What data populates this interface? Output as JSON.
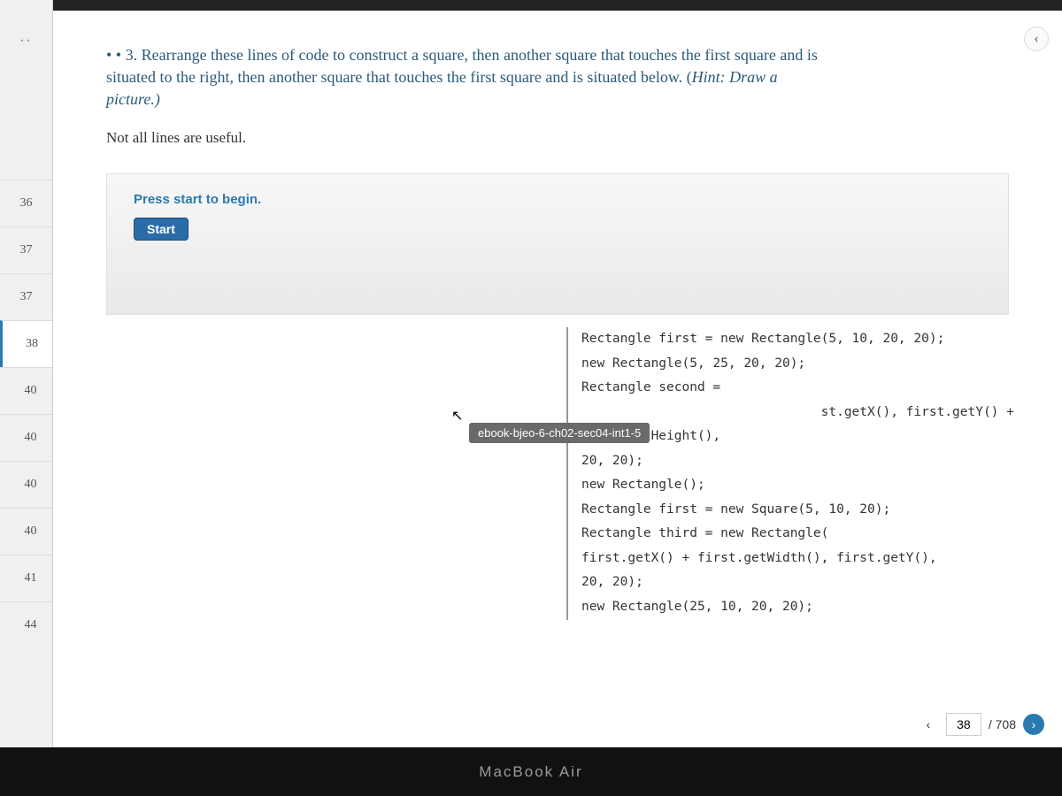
{
  "sidebar": {
    "ellipsis": "..",
    "thumbs": [
      "36",
      "37",
      "37",
      "38",
      "40",
      "40",
      "40",
      "40",
      "41",
      "44"
    ],
    "active_index": 3
  },
  "collapse_glyph": "‹",
  "problem": {
    "bullet": "• •",
    "number": "3.",
    "text_line1": "Rearrange these lines of code to construct a square, then another square that touches the first square and is",
    "text_line2": "situated to the right, then another square that touches the first square and is situated below. (",
    "hint_label": "Hint:",
    "hint_text": " Draw a",
    "text_line3": "picture.)",
    "not_useful": "Not all lines are useful."
  },
  "exercise": {
    "press_start": "Press start to begin.",
    "start_label": "Start"
  },
  "tooltip": {
    "cursor": "↖",
    "text": "ebook-bjeo-6-ch02-sec04-int1-5"
  },
  "code_lines": [
    "Rectangle first = new Rectangle(5, 10, 20, 20);",
    "new Rectangle(5, 25, 20, 20);",
    "Rectangle second =",
    "st.getX(), first.getY() + first.getHeight(),",
    "20, 20);",
    "new Rectangle();",
    "Rectangle first = new Square(5, 10, 20);",
    "Rectangle third = new Rectangle(",
    "first.getX() + first.getWidth(), first.getY(),",
    "20, 20);",
    "new Rectangle(25, 10, 20, 20);"
  ],
  "pager": {
    "prev": "‹",
    "current": "38",
    "total": "/ 708",
    "next": "›"
  },
  "bottom": {
    "label": "MacBook Air"
  }
}
